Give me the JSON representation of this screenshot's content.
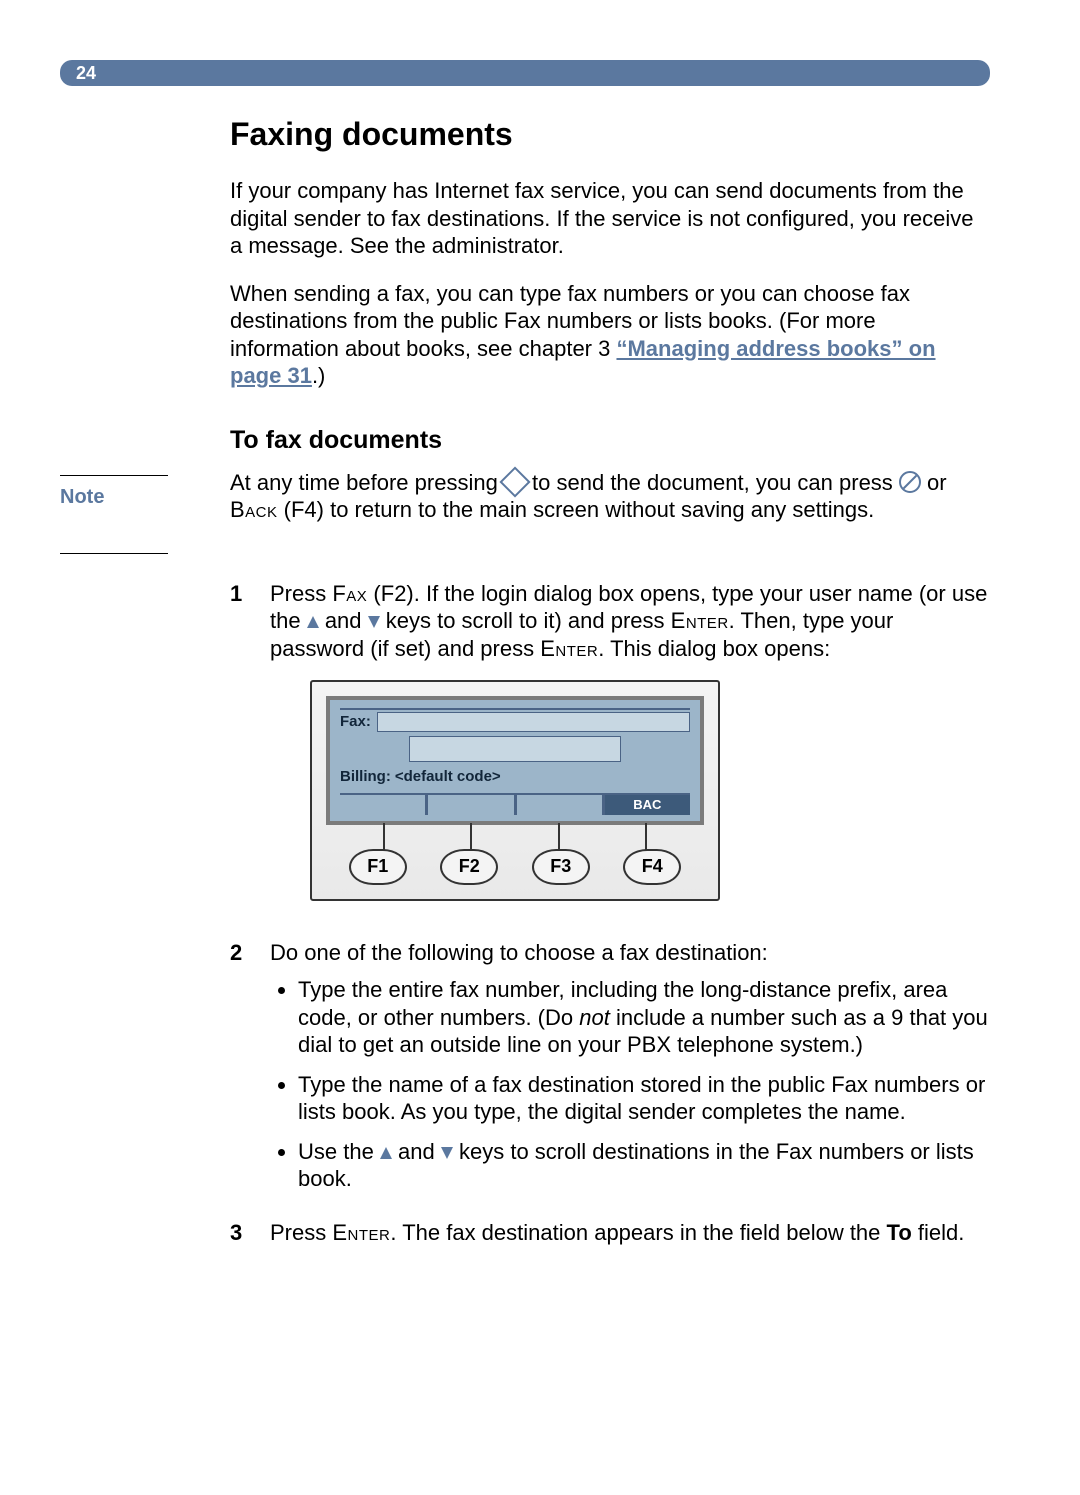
{
  "page_number": "24",
  "title": "Faxing documents",
  "intro": [
    "If your company has Internet fax service, you can send documents from the digital sender to fax destinations. If the service is not configured, you receive a message. See the administrator."
  ],
  "intro2_pre": "When sending a fax, you can type fax numbers or you can choose fax destinations from the public Fax numbers or lists books. (For more information about books, see chapter 3 ",
  "link_text": "“Managing address books” on page 31",
  "intro2_post": ".)",
  "subhead": "To fax documents",
  "note_label": "Note",
  "note_pre": "At any time before pressing ",
  "note_mid": " to send the document, you can press ",
  "note_or": " or ",
  "note_back": "Back",
  "note_f4": " (F4) to return to the main screen without saving any settings.",
  "step1_num": "1",
  "step1_a": "Press ",
  "step1_fax": "Fax",
  "step1_b": " (F2). If the login dialog box opens, type your user name (or use the ",
  "step1_c": " and ",
  "step1_d": " keys to scroll to it) and press ",
  "step1_enter1": "Enter",
  "step1_e": ". Then, type your password (if set) and press ",
  "step1_enter2": "Enter",
  "step1_f": ". This dialog box opens:",
  "device": {
    "fax_label": "Fax:",
    "billing_label": "Billing:",
    "billing_value": "<default code>",
    "bac": "BAC",
    "f1": "F1",
    "f2": "F2",
    "f3": "F3",
    "f4": "F4"
  },
  "step2_num": "2",
  "step2_text": "Do one of the following to choose a fax destination:",
  "bullet1_a": "Type the entire fax number, including the long-distance prefix, area code, or other numbers. (Do ",
  "bullet1_not": "not",
  "bullet1_b": " include a number such as a 9 that you dial to get an outside line on your PBX telephone system.)",
  "bullet2": "Type the name of a fax destination stored in the public Fax numbers or lists book. As you type, the digital sender completes the name.",
  "bullet3_a": "Use the ",
  "bullet3_b": " and ",
  "bullet3_c": " keys to scroll destinations in the Fax numbers or lists book.",
  "step3_num": "3",
  "step3_a": "Press ",
  "step3_enter": "Enter",
  "step3_b": ". The fax destination appears in the field below the ",
  "step3_to": "To",
  "step3_c": " field."
}
